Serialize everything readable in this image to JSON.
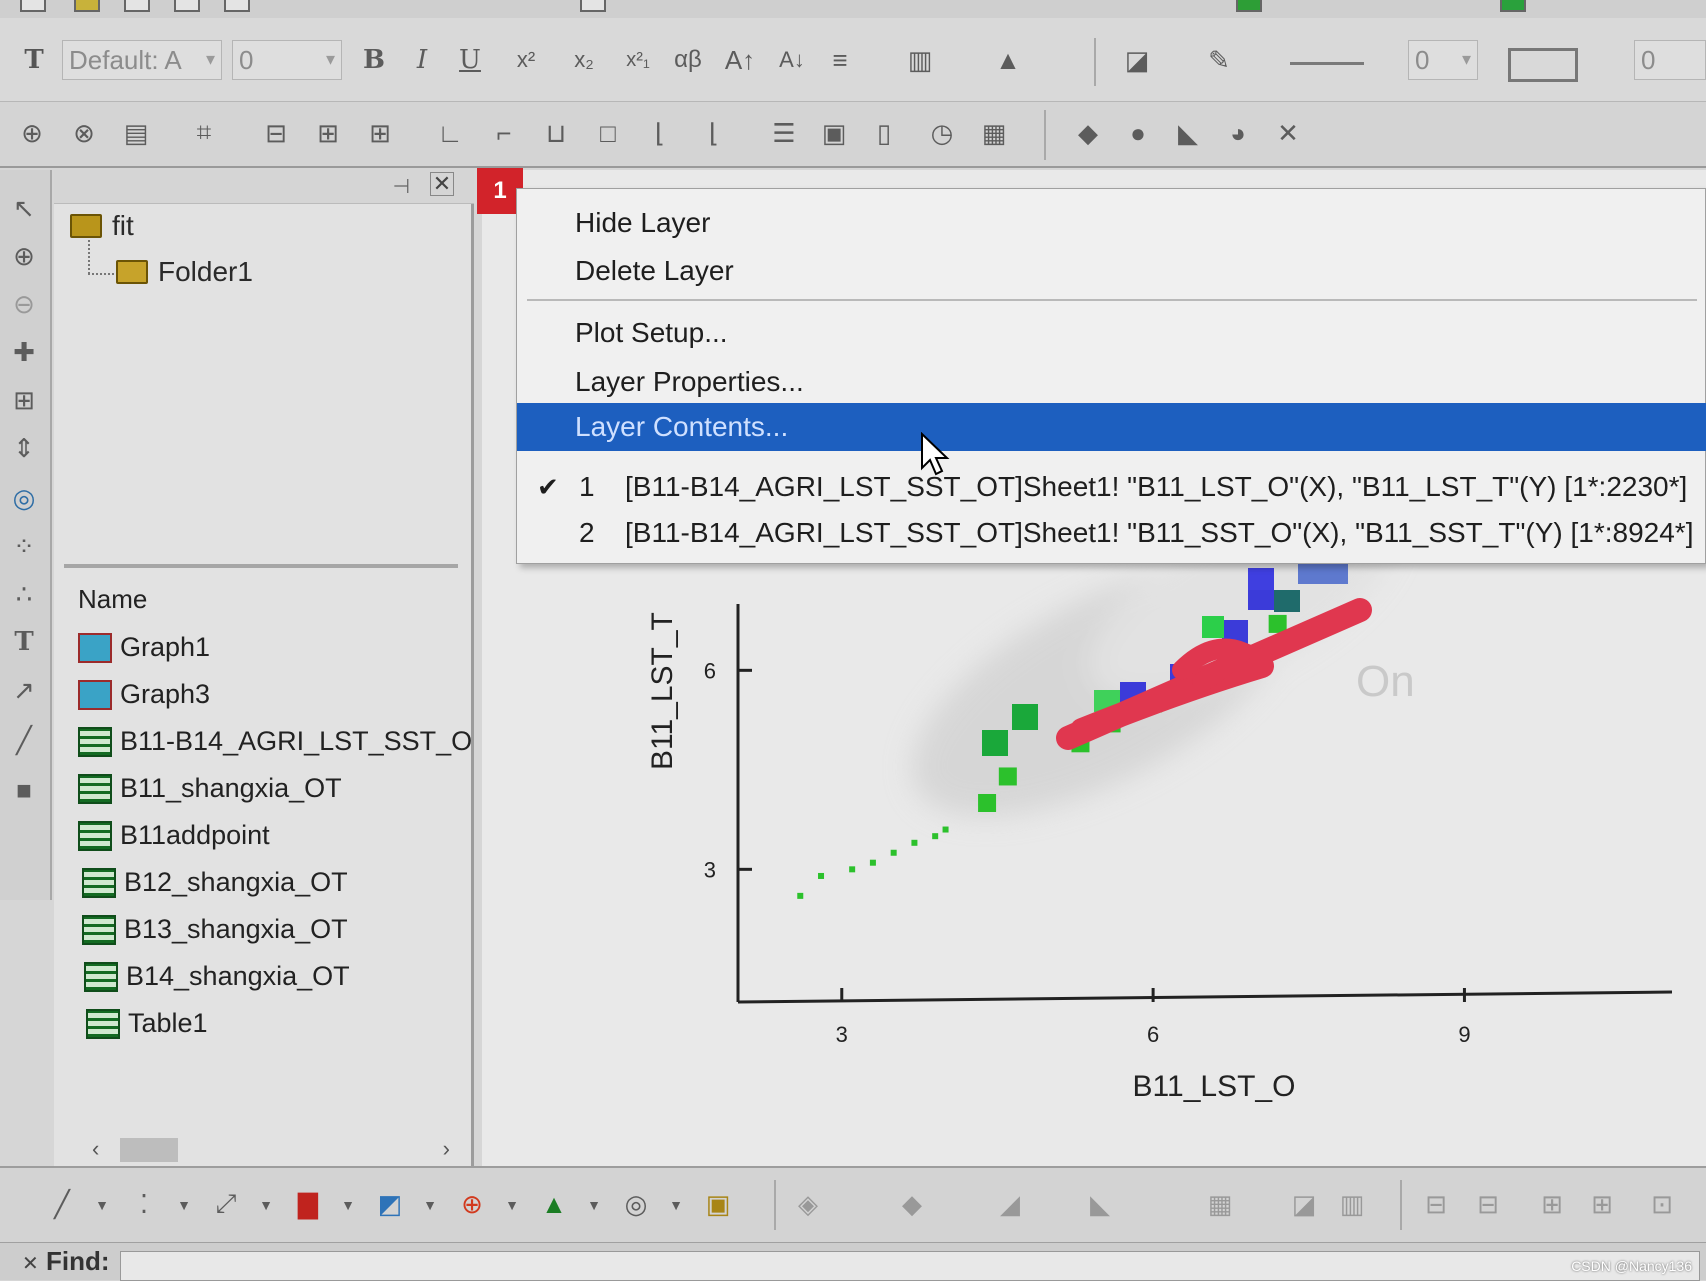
{
  "format_toolbar": {
    "font_name": "Default: A",
    "font_size": "0",
    "line_width": "0",
    "border_value": "0",
    "buttons": [
      "B",
      "I",
      "U",
      "x²",
      "x₂",
      "x²₁",
      "αβ",
      "A↑",
      "A↓"
    ]
  },
  "explorer": {
    "tree": {
      "root": "fit",
      "child": "Folder1"
    },
    "list_header": "Name",
    "items": [
      {
        "label": "Graph1",
        "kind": "graph"
      },
      {
        "label": "Graph3",
        "kind": "graph"
      },
      {
        "label": "B11-B14_AGRI_LST_SST_O",
        "kind": "sheet"
      },
      {
        "label": "B11_shangxia_OT",
        "kind": "sheet"
      },
      {
        "label": "B11addpoint",
        "kind": "sheet"
      },
      {
        "label": "B12_shangxia_OT",
        "kind": "sheet"
      },
      {
        "label": "B13_shangxia_OT",
        "kind": "sheet"
      },
      {
        "label": "B14_shangxia_OT",
        "kind": "sheet"
      },
      {
        "label": "Table1",
        "kind": "sheet"
      }
    ]
  },
  "layer_indicator": "1",
  "context_menu": {
    "items": [
      {
        "label": "Hide Layer"
      },
      {
        "label": "Delete Layer"
      },
      {
        "label": "Plot Setup..."
      },
      {
        "label": "Layer Properties..."
      },
      {
        "label": "Layer Contents...",
        "highlighted": true
      }
    ],
    "plots": [
      {
        "number": "1",
        "checked": true,
        "text": "[B11-B14_AGRI_LST_SST_OT]Sheet1! \"B11_LST_O\"(X), \"B11_LST_T\"(Y) [1*:2230*]"
      },
      {
        "number": "2",
        "checked": false,
        "text": "[B11-B14_AGRI_LST_SST_OT]Sheet1! \"B11_SST_O\"(X), \"B11_SST_T\"(Y) [1*:8924*]"
      }
    ]
  },
  "graph": {
    "background_text": "On",
    "colors": {
      "series": "#2cc12c",
      "density_blue": "#3b3bd9",
      "annotation": "#e0374f"
    }
  },
  "chart_data": {
    "type": "scatter",
    "xlabel": "B11_LST_O",
    "ylabel": "B11_LST_T",
    "xticks": [
      "3",
      "6",
      "9"
    ],
    "yticks": [
      "3",
      "6"
    ],
    "xlim": [
      2,
      11
    ],
    "ylim": [
      1,
      7
    ],
    "series": [
      {
        "x": [
          2.6,
          2.8,
          3.1,
          3.3,
          3.5,
          3.7,
          3.9,
          4.0,
          4.4,
          4.6,
          5.3,
          5.6,
          6.0,
          6.4,
          6.8,
          7.2
        ],
        "y": [
          2.6,
          2.9,
          3.0,
          3.1,
          3.25,
          3.4,
          3.5,
          3.6,
          4.0,
          4.4,
          4.9,
          5.2,
          5.5,
          5.9,
          6.2,
          6.7
        ]
      }
    ]
  },
  "find_label": "Find:",
  "watermark": "CSDN @Nancy136"
}
